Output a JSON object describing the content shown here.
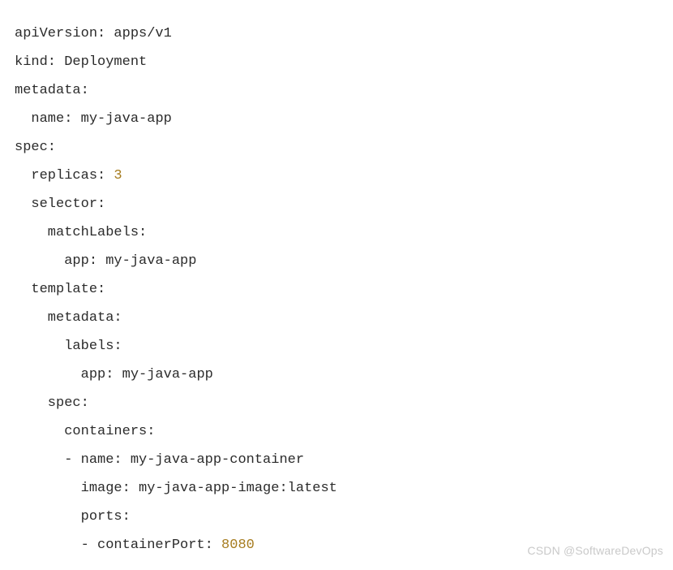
{
  "yaml": {
    "apiVersion_key": "apiVersion:",
    "apiVersion_val": " apps/v1",
    "kind_key": "kind:",
    "kind_val": " Deployment",
    "metadata_key": "metadata:",
    "metadata_name_key": "  name:",
    "metadata_name_val": " my-java-app",
    "spec_key": "spec:",
    "replicas_key": "  replicas:",
    "replicas_val": " 3",
    "selector_key": "  selector:",
    "matchLabels_key": "    matchLabels:",
    "matchLabels_app_key": "      app:",
    "matchLabels_app_val": " my-java-app",
    "template_key": "  template:",
    "tpl_metadata_key": "    metadata:",
    "tpl_labels_key": "      labels:",
    "tpl_labels_app_key": "        app:",
    "tpl_labels_app_val": " my-java-app",
    "tpl_spec_key": "    spec:",
    "containers_key": "      containers:",
    "container_name_key": "      - name:",
    "container_name_val": " my-java-app-container",
    "container_image_key": "        image:",
    "container_image_val": " my-java-app-image:latest",
    "container_ports_key": "        ports:",
    "container_port_key": "        - containerPort:",
    "container_port_val": " 8080"
  },
  "watermark": "CSDN @SoftwareDevOps"
}
